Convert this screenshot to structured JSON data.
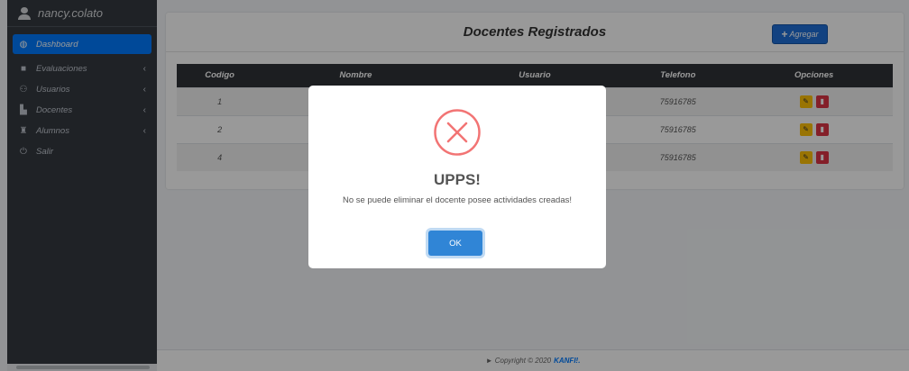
{
  "sidebar": {
    "username": "nancy.colato",
    "items": [
      {
        "label": "Dashboard",
        "icon": "dashboard-icon",
        "active": true
      },
      {
        "label": "Evaluaciones",
        "icon": "folder-icon",
        "chevron": true
      },
      {
        "label": "Usuarios",
        "icon": "users-icon",
        "chevron": true
      },
      {
        "label": "Docentes",
        "icon": "teacher-icon",
        "chevron": true
      },
      {
        "label": "Alumnos",
        "icon": "student-icon",
        "chevron": true
      },
      {
        "label": "Salir",
        "icon": "power-icon"
      }
    ]
  },
  "card": {
    "title": "Docentes Registrados",
    "add_label": "Agregar"
  },
  "table": {
    "headers": [
      "Codigo",
      "Nombre",
      "Usuario",
      "Telefono",
      "Opciones"
    ],
    "rows": [
      {
        "codigo": "1",
        "nombre": "",
        "usuario": "",
        "telefono": "75916785"
      },
      {
        "codigo": "2",
        "nombre": "",
        "usuario": "",
        "telefono": "75916785"
      },
      {
        "codigo": "4",
        "nombre": "",
        "usuario": "",
        "telefono": "75916785"
      }
    ]
  },
  "footer": {
    "prefix": "► Copyright © 2020",
    "brand": "KANFI!."
  },
  "modal": {
    "title": "UPPS!",
    "message": "No se puede eliminar el docente posee actividades creadas!",
    "ok_label": "OK"
  },
  "colors": {
    "sidebar_bg": "#343a40",
    "accent": "#007bff",
    "edit": "#ffc107",
    "delete": "#dc3545",
    "error": "#f27474",
    "confirm": "#3085d6"
  }
}
